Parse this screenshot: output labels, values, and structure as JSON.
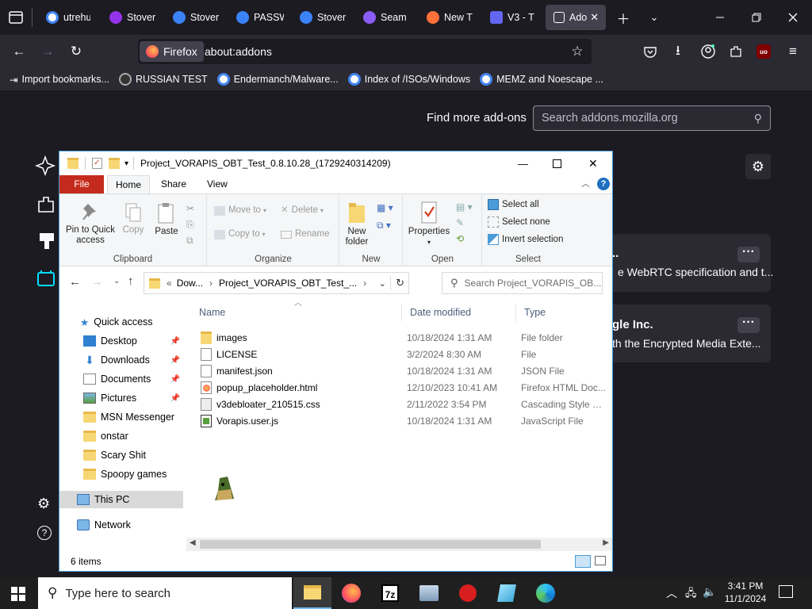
{
  "browser": {
    "tabs": [
      {
        "label": "utrehu",
        "color": "#4285f4"
      },
      {
        "label": "Stover",
        "color": "#9333ea"
      },
      {
        "label": "Stover",
        "color": "#3b82f6"
      },
      {
        "label": "PASSW",
        "color": "#3b82f6"
      },
      {
        "label": "Stover",
        "color": "#3b82f6"
      },
      {
        "label": "Seam",
        "color": "#8b5cf6"
      },
      {
        "label": "New T",
        "color": "#ff7139"
      },
      {
        "label": "V3 - T",
        "color": "#6366f1"
      },
      {
        "label": "Ado",
        "color": "#fbfbfe"
      }
    ],
    "identity_label": "Firefox",
    "url": "about:addons",
    "bookmarks": [
      "Import bookmarks...",
      "RUSSIAN TEST",
      "Endermanch/Malware...",
      "Index of /ISOs/Windows",
      "MEMZ and Noescape ..."
    ]
  },
  "addons_page": {
    "find_more_label": "Find more add-ons",
    "search_placeholder": "Search addons.mozilla.org",
    "cards": [
      {
        "title": "..",
        "desc": "e WebRTC specification and t..."
      },
      {
        "title": "gle Inc.",
        "desc": "th the Encrypted Media Exte..."
      }
    ]
  },
  "explorer": {
    "title": "Project_VORAPIS_OBT_Test_0.8.10.28_(1729240314209)",
    "ribbon_tabs": [
      "File",
      "Home",
      "Share",
      "View"
    ],
    "ribbon": {
      "clipboard": {
        "pin": "Pin to Quick access",
        "copy": "Copy",
        "paste": "Paste",
        "label": "Clipboard"
      },
      "organize": {
        "move_to": "Move to",
        "copy_to": "Copy to",
        "delete": "Delete",
        "rename": "Rename",
        "label": "Organize"
      },
      "new": {
        "new_folder": "New folder",
        "label": "New"
      },
      "open": {
        "properties": "Properties",
        "label": "Open"
      },
      "select": {
        "select_all": "Select all",
        "select_none": "Select none",
        "invert": "Invert selection",
        "label": "Select"
      }
    },
    "address": {
      "crumb1": "Dow...",
      "crumb2": "Project_VORAPIS_OBT_Test_..."
    },
    "search_placeholder": "Search Project_VORAPIS_OB...",
    "nav": {
      "quick_access": "Quick access",
      "items": [
        {
          "label": "Desktop",
          "pinned": true
        },
        {
          "label": "Downloads",
          "pinned": true
        },
        {
          "label": "Documents",
          "pinned": true
        },
        {
          "label": "Pictures",
          "pinned": true
        },
        {
          "label": "MSN Messenger",
          "pinned": false
        },
        {
          "label": "onstar",
          "pinned": false
        },
        {
          "label": "Scary Shit",
          "pinned": false
        },
        {
          "label": "Spoopy games",
          "pinned": false
        }
      ],
      "this_pc": "This PC",
      "network": "Network"
    },
    "columns": {
      "name": "Name",
      "date": "Date modified",
      "type": "Type"
    },
    "files": [
      {
        "name": "images",
        "date": "10/18/2024 1:31 AM",
        "type": "File folder",
        "kind": "folder"
      },
      {
        "name": "LICENSE",
        "date": "3/2/2024 8:30 AM",
        "type": "File",
        "kind": "file"
      },
      {
        "name": "manifest.json",
        "date": "10/18/2024 1:31 AM",
        "type": "JSON File",
        "kind": "file"
      },
      {
        "name": "popup_placeholder.html",
        "date": "12/10/2023 10:41 AM",
        "type": "Firefox HTML Doc...",
        "kind": "html"
      },
      {
        "name": "v3debloater_210515.css",
        "date": "2/11/2022 3:54 PM",
        "type": "Cascading Style S...",
        "kind": "css"
      },
      {
        "name": "Vorapis.user.js",
        "date": "10/18/2024 1:31 AM",
        "type": "JavaScript File",
        "kind": "js"
      }
    ],
    "status": "6 items"
  },
  "taskbar": {
    "search_placeholder": "Type here to search",
    "time": "3:41 PM",
    "date": "11/1/2024"
  }
}
